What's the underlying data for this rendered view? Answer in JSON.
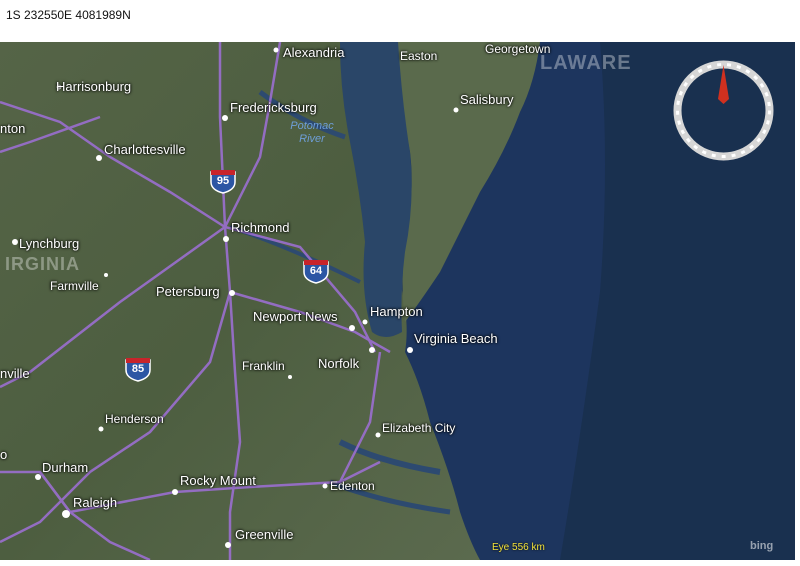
{
  "coordinate_readout": "1S 232550E 4081989N",
  "map": {
    "cities": {
      "alexandria": "Alexandria",
      "easton": "Easton",
      "georgetown": "Georgetown",
      "harrisonburg": "Harrisonburg",
      "fredericksburg": "Fredericksburg",
      "salisbury": "Salisbury",
      "charlottesville": "Charlottesville",
      "richmond": "Richmond",
      "lynchburg": "Lynchburg",
      "farmville": "Farmville",
      "petersburg": "Petersburg",
      "hampton": "Hampton",
      "newport_news": "Newport News",
      "virginia_beach": "Virginia Beach",
      "norfolk": "Norfolk",
      "franklin": "Franklin",
      "henderson": "Henderson",
      "elizabeth_city": "Elizabeth City",
      "durham": "Durham",
      "rocky_mount": "Rocky Mount",
      "edenton": "Edenton",
      "raleigh": "Raleigh",
      "greenville": "Greenville",
      "nton_partial": "nton",
      "nville_partial": "nville",
      "o_partial": "o"
    },
    "water_label": "Potomac River",
    "state_labels": {
      "delaware_partial": "LAWARE",
      "virginia_partial": "IRGINIA"
    },
    "interstates": [
      "95",
      "64",
      "85"
    ],
    "eye_altitude": "Eye  556 km",
    "attribution": "bing",
    "colors": {
      "ocean": "#1e3760",
      "land": "#4a5c3e",
      "roads": "#9b6fd0",
      "compass_needle": "#d0301f"
    }
  }
}
